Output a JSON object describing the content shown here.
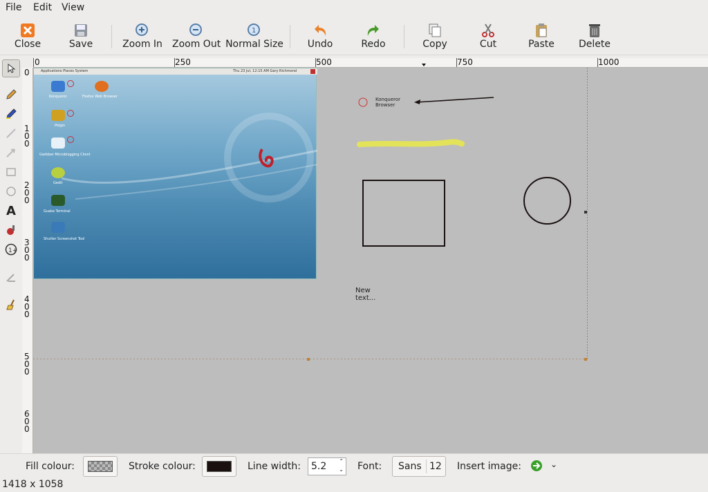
{
  "menu": {
    "file": "File",
    "edit": "Edit",
    "view": "View"
  },
  "toolbar": {
    "close": "Close",
    "save": "Save",
    "zoom_in": "Zoom In",
    "zoom_out": "Zoom Out",
    "normal_size": "Normal Size",
    "undo": "Undo",
    "redo": "Redo",
    "copy": "Copy",
    "cut": "Cut",
    "paste": "Paste",
    "delete": "Delete"
  },
  "tools": [
    "select-tool",
    "pencil-tool",
    "highlighter-tool",
    "line-tool",
    "arrow-tool",
    "rectangle-tool",
    "ellipse-tool",
    "text-tool",
    "censor-tool",
    "number-tool",
    "crop-tool",
    "clear-tool"
  ],
  "ruler_top": {
    "t0": "0",
    "t250": "250",
    "t500": "500",
    "t750": "750",
    "t1000": "1000"
  },
  "ruler_left": {
    "t0": "0",
    "t100": "1\n0\n0",
    "t200": "2\n0\n0",
    "t300": "3\n0\n0",
    "t400": "4\n0\n0",
    "t500": "5\n0\n0",
    "t600": "6\n0\n0"
  },
  "screenshot": {
    "panel": "Applications  Places  System",
    "clock": "Thu 23 Jul, 12:15 AM   Gary Richmond",
    "icons": [
      "Konqueror",
      "Firefox Web Browser",
      "Pidgin",
      "Gwibber Microblogging Client",
      "Gedit",
      "Guake Terminal",
      "Shutter Screenshot Tool"
    ]
  },
  "annotations": {
    "konqueror_label": "Konqueror\nBrowser",
    "new_text": "New\ntext..."
  },
  "bottom": {
    "fill_label": "Fill colour:",
    "stroke_label": "Stroke colour:",
    "line_width_label": "Line width:",
    "line_width_value": "5.2",
    "font_label": "Font:",
    "font_name": "Sans",
    "font_size": "12",
    "insert_image_label": "Insert image:"
  },
  "colors": {
    "stroke": "#1a1010",
    "highlight": "#e3e35a",
    "accent_red": "#cc3333"
  },
  "status": {
    "dimensions": "1418 x 1058"
  }
}
